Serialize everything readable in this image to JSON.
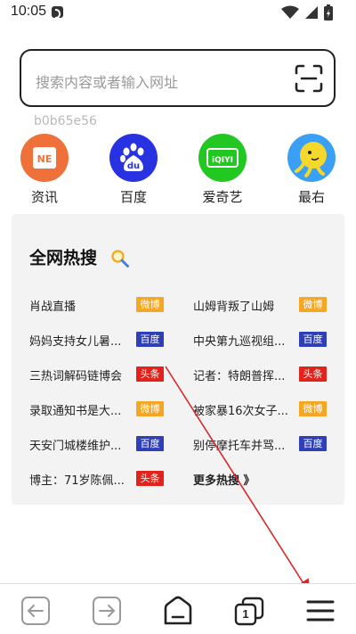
{
  "status": {
    "time": "10:05"
  },
  "search": {
    "placeholder": "搜索内容或者输入网址"
  },
  "device_code": "b0b65e56",
  "shortcuts": [
    {
      "label": "资讯",
      "icon": "news-icon",
      "color": "#f0703a",
      "glyph": "NE"
    },
    {
      "label": "百度",
      "icon": "baidu-icon",
      "color": "#2932e1",
      "glyph": "du"
    },
    {
      "label": "爱奇艺",
      "icon": "iqiyi-icon",
      "color": "#22c721",
      "glyph": "iQIYI"
    },
    {
      "label": "最右",
      "icon": "zuiyou-icon",
      "color": "#3aa0f5",
      "glyph": ""
    }
  ],
  "hot": {
    "title": "全网热搜",
    "items": [
      {
        "text": "肖战直播",
        "source": "微博"
      },
      {
        "text": "山姆背叛了山姆",
        "source": "微博"
      },
      {
        "text": "妈妈支持女儿暑...",
        "source": "百度"
      },
      {
        "text": "中央第九巡视组...",
        "source": "百度"
      },
      {
        "text": "三热词解码链博会",
        "source": "头条"
      },
      {
        "text": "记者：特朗普挥...",
        "source": "头条"
      },
      {
        "text": "录取通知书是大...",
        "source": "微博"
      },
      {
        "text": "被家暴16次女子...",
        "source": "微博"
      },
      {
        "text": "天安门城楼维护...",
        "source": "百度"
      },
      {
        "text": "别停摩托车并骂...",
        "source": "百度"
      },
      {
        "text": "博主：71岁陈佩...",
        "source": "头条"
      }
    ],
    "more": "更多热搜 》"
  },
  "badge_colors": {
    "微博": "#f5a623",
    "百度": "#2f3fb8",
    "头条": "#e3231b"
  },
  "toolbar": {
    "tab_count": "1"
  }
}
